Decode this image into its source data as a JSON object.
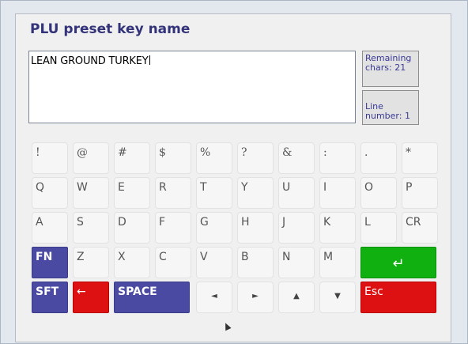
{
  "dialog": {
    "title": "PLU preset key name"
  },
  "editor": {
    "value": "LEAN GROUND TURKEY"
  },
  "info": {
    "remaining": "Remaining chars: 21",
    "line": "Line number: 1"
  },
  "keys": {
    "row1": [
      "!",
      "@",
      "#",
      "$",
      "%",
      "?",
      "&",
      ":",
      ".",
      "*"
    ],
    "row2": [
      "Q",
      "W",
      "E",
      "R",
      "T",
      "Y",
      "U",
      "I",
      "O",
      "P"
    ],
    "row3": [
      "A",
      "S",
      "D",
      "F",
      "G",
      "H",
      "J",
      "K",
      "L",
      "CR"
    ],
    "row4": [
      "FN",
      "Z",
      "X",
      "C",
      "V",
      "B",
      "N",
      "M",
      "↵"
    ],
    "row5": [
      "SFT",
      "←",
      "SPACE",
      "◄",
      "►",
      "▲",
      "▼",
      "Esc"
    ]
  },
  "colors": {
    "fn_sft_space": "#4a4aa2",
    "esc_back": "#dd1111",
    "enter": "#10b010",
    "title": "#33337a"
  }
}
